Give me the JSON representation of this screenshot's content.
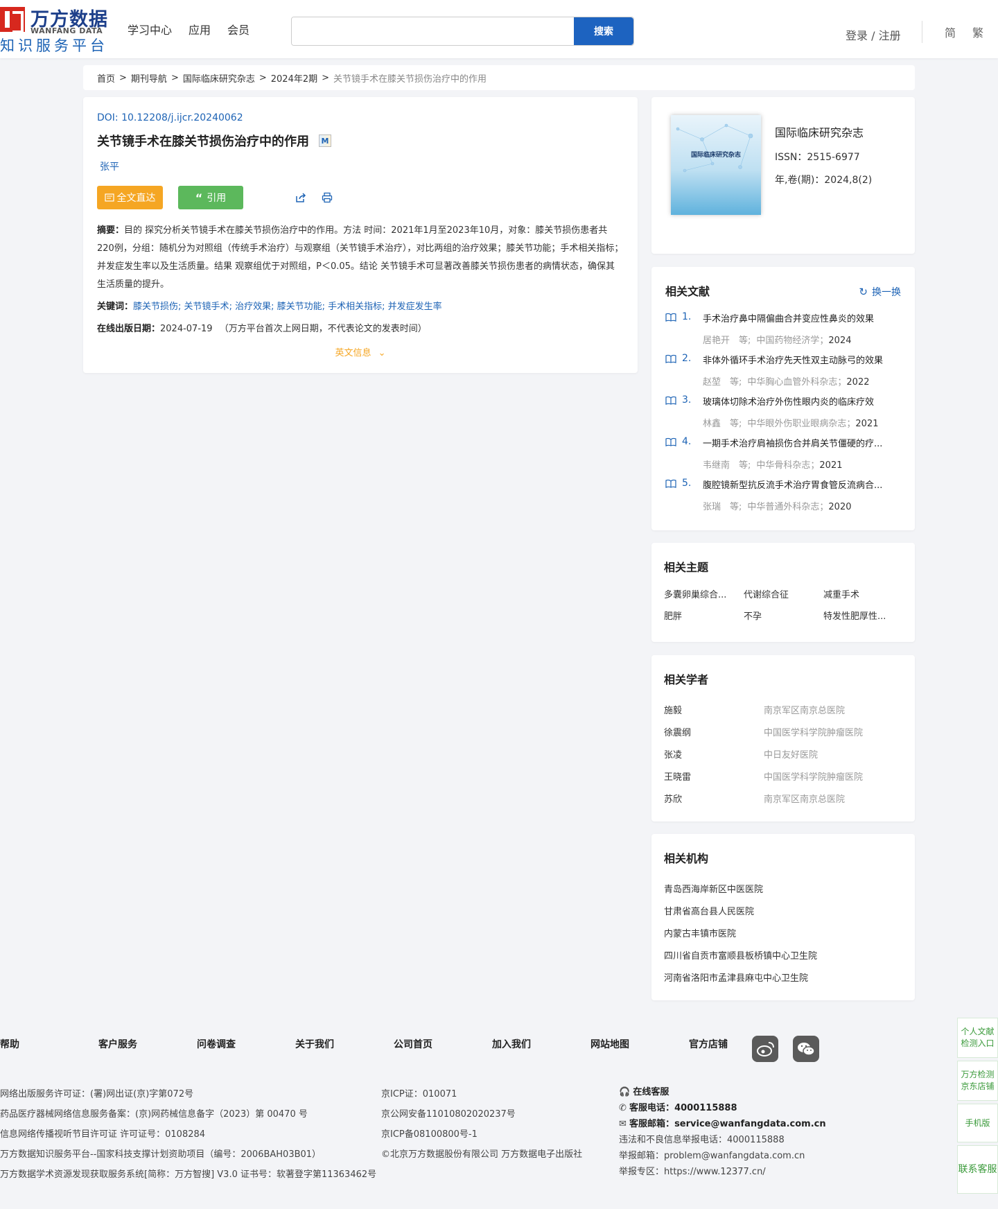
{
  "header": {
    "logo_cn": "万方数据",
    "logo_en": "WANFANG DATA",
    "logo_sub": "知识服务平台",
    "nav": [
      "学习中心",
      "应用",
      "会员"
    ],
    "search_placeholder": "",
    "search_button": "搜索",
    "login": "登录 / 注册",
    "lang_simplified": "简",
    "lang_traditional": "繁"
  },
  "breadcrumb": {
    "items": [
      "首页",
      "期刊导航",
      "国际临床研究杂志",
      "2024年2期"
    ],
    "separator": ">",
    "current": "关节镜手术在膝关节损伤治疗中的作用"
  },
  "article": {
    "doi_label": "DOI:",
    "doi": "10.12208/j.ijcr.20240062",
    "title": "关节镜手术在膝关节损伤治疗中的作用",
    "badge": "M",
    "author": "张平",
    "fulltext_button": "全文直达",
    "cite_button": "引用",
    "abstract_label": "摘要：",
    "abstract": "目的 探究分析关节镜手术在膝关节损伤治疗中的作用。方法 时间：2021年1月至2023年10月，对象：膝关节损伤患者共220例，分组：随机分为对照组（传统手术治疗）与观察组（关节镜手术治疗），对比两组的治疗效果；膝关节功能；手术相关指标；并发症发生率以及生活质量。结果 观察组优于对照组，P＜0.05。结论 关节镜手术可显著改善膝关节损伤患者的病情状态，确保其生活质量的提升。",
    "keywords_label": "关键词：",
    "keywords": [
      "膝关节损伤",
      "关节镜手术",
      "治疗效果",
      "膝关节功能",
      "手术相关指标",
      "并发症发生率"
    ],
    "pubdate_label": "在线出版日期：",
    "pubdate": "2024-07-19",
    "pubdate_note": "（万方平台首次上网日期，不代表论文的发表时间）",
    "english_info": "英文信息"
  },
  "journal": {
    "name": "国际临床研究杂志",
    "cover_title": "国际临床研究杂志",
    "issn": "ISSN：2515-6977",
    "volume": "年,卷(期)：2024,8(2)"
  },
  "related_literature": {
    "title": "相关文献",
    "refresh": "换一换",
    "items": [
      {
        "num": "1.",
        "title": "手术治疗鼻中隔偏曲合并变应性鼻炎的效果",
        "authors": "居艳开　等;",
        "source": "中国药物经济学；",
        "year": "2024"
      },
      {
        "num": "2.",
        "title": "非体外循环手术治疗先天性双主动脉弓的效果",
        "authors": "赵堃　等;",
        "source": "中华胸心血管外科杂志；",
        "year": "2022"
      },
      {
        "num": "3.",
        "title": "玻璃体切除术治疗外伤性眼内炎的临床疗效",
        "authors": "林鑫　等;",
        "source": "中华眼外伤职业眼病杂志；",
        "year": "2021"
      },
      {
        "num": "4.",
        "title": "一期手术治疗肩袖损伤合并肩关节僵硬的疗...",
        "authors": "韦继南　等;",
        "source": "中华骨科杂志；",
        "year": "2021"
      },
      {
        "num": "5.",
        "title": "腹腔镜新型抗反流手术治疗胃食管反流病合...",
        "authors": "张瑞　等;",
        "source": "中华普通外科杂志；",
        "year": "2020"
      }
    ]
  },
  "related_topics": {
    "title": "相关主题",
    "items": [
      "多囊卵巢综合...",
      "代谢综合征",
      "减重手术",
      "肥胖",
      "不孕",
      "特发性肥厚性..."
    ]
  },
  "related_scholars": {
    "title": "相关学者",
    "items": [
      {
        "name": "施毅",
        "org": "南京军区南京总医院"
      },
      {
        "name": "徐震纲",
        "org": "中国医学科学院肿瘤医院"
      },
      {
        "name": "张凌",
        "org": "中日友好医院"
      },
      {
        "name": "王晓雷",
        "org": "中国医学科学院肿瘤医院"
      },
      {
        "name": "苏欣",
        "org": "南京军区南京总医院"
      }
    ]
  },
  "related_institutions": {
    "title": "相关机构",
    "items": [
      "青岛西海岸新区中医医院",
      "甘肃省高台县人民医院",
      "内蒙古丰镇市医院",
      "四川省自贡市富顺县板桥镇中心卫生院",
      "河南省洛阳市孟津县麻屯中心卫生院"
    ]
  },
  "footer": {
    "nav": [
      "帮助",
      "客户服务",
      "问卷调查",
      "关于我们",
      "公司首页",
      "加入我们",
      "网站地图",
      "官方店铺"
    ],
    "licenses_col1": [
      "网络出版服务许可证：(署)网出证(京)字第072号",
      "药品医疗器械网络信息服务备案：(京)网药械信息备字（2023）第 00470 号",
      "信息网络传播视听节目许可证 许可证号：0108284",
      "万方数据知识服务平台--国家科技支撑计划资助项目（编号：2006BAH03B01）",
      "万方数据学术资源发现获取服务系统[简称：万方智搜] V3.0 证书号：软著登字第11363462号"
    ],
    "licenses_col2": [
      "京ICP证：010071",
      "京公网安备11010802020237号",
      "京ICP备08100800号-1",
      "©北京万方数据股份有限公司 万方数据电子出版社"
    ],
    "online_service": "在线客服",
    "phone_label": "客服电话：",
    "phone": "4000115888",
    "email_label": "客服邮箱：",
    "email": "service@wanfangdata.com.cn",
    "report_phone": "违法和不良信息举报电话：4000115888",
    "report_email": "举报邮箱：problem@wanfangdata.com.cn",
    "report_site": "举报专区：https://www.12377.cn/"
  },
  "side_buttons": [
    "个人文献检测入口",
    "万方检测京东店铺",
    "手机版",
    "联系客服"
  ]
}
